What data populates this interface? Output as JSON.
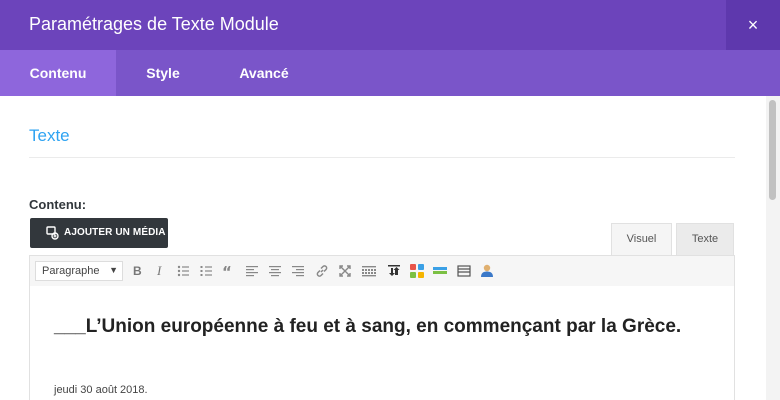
{
  "header": {
    "title": "Paramétrages de Texte Module",
    "close_glyph": "×"
  },
  "tabs": [
    {
      "label": "Contenu",
      "active": true
    },
    {
      "label": "Style",
      "active": false
    },
    {
      "label": "Avancé",
      "active": false
    }
  ],
  "section": {
    "title": "Texte"
  },
  "field": {
    "label": "Contenu:"
  },
  "media_button": {
    "label": "AJOUTER UN MÉDIA",
    "icon": "add-media-icon"
  },
  "editor_modes": {
    "visual": "Visuel",
    "text": "Texte",
    "active": "Visuel"
  },
  "toolbar": {
    "format_select": "Paragraphe",
    "buttons": [
      "bold-icon",
      "italic-icon",
      "bullet-list-icon",
      "numbered-list-icon",
      "blockquote-icon",
      "align-left-icon",
      "align-center-icon",
      "align-right-icon",
      "link-icon",
      "fullscreen-icon",
      "toolbar-toggle-icon",
      "download-icon",
      "layout-grid-icon",
      "divider-icon",
      "table-icon",
      "user-icon"
    ]
  },
  "editor": {
    "heading": "___L’Union européenne à feu et à sang, en commençant par la Grèce.",
    "date": "jeudi 30 août 2018."
  },
  "colors": {
    "header": "#6c44bb",
    "tabbar": "#7a55c9",
    "active_tab": "#8e66dc",
    "accent_title": "#2ea3f2",
    "media_button": "#32373c"
  }
}
